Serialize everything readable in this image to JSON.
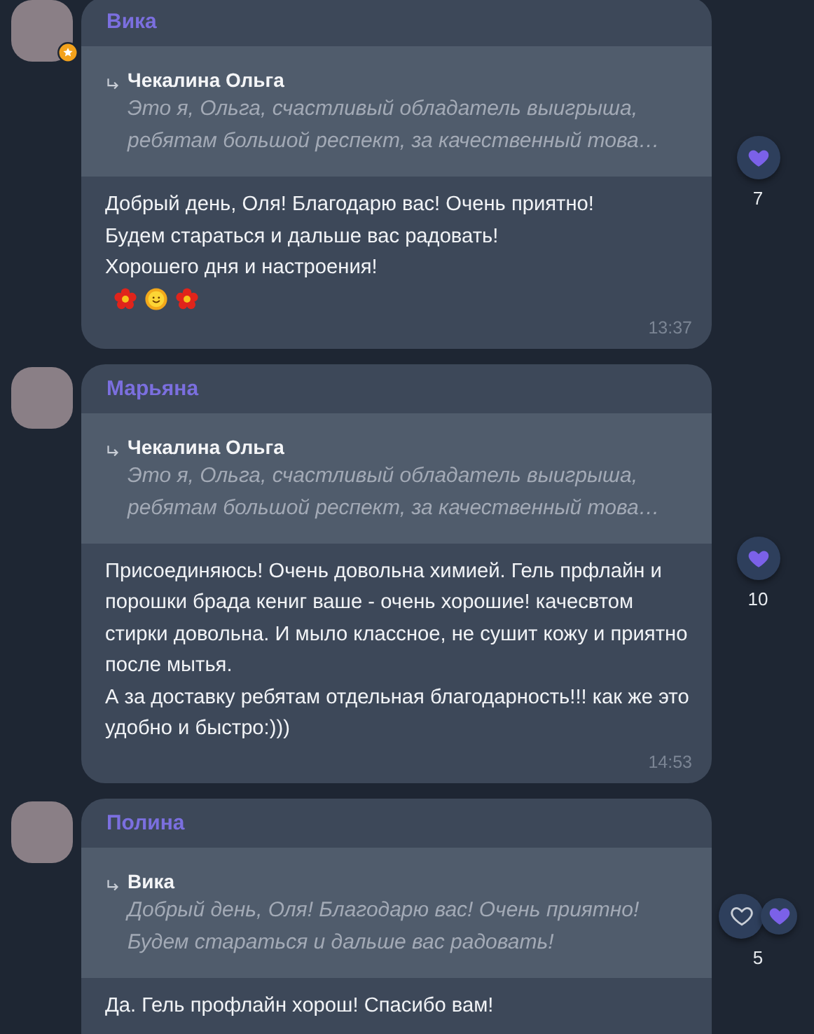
{
  "messages": [
    {
      "author": "Вика",
      "avatar_badge": true,
      "reply": {
        "author": "Чекалина Ольга",
        "text": "Это я, Ольга, счастливый обладатель выигрыша,\nребятам большой респект, за качественный това…"
      },
      "text": "Добрый день, Оля! Благодарю вас! Очень приятно!\nБудем стараться и дальше вас радовать!\nХорошего дня и настроения!",
      "emoji": [
        {
          "kind": "flower"
        },
        {
          "kind": "sun"
        },
        {
          "kind": "flower"
        }
      ],
      "time": "13:37",
      "reactions": {
        "hearts": [
          {
            "filled": true
          }
        ],
        "count": "7"
      }
    },
    {
      "author": "Марьяна",
      "avatar_badge": false,
      "reply": {
        "author": "Чекалина Ольга",
        "text": "Это я, Ольга, счастливый обладатель выигрыша,\nребятам большой респект, за качественный това…"
      },
      "text": "Присоединяюсь! Очень довольна химией. Гель прфлайн и порошки брада кениг ваше - очень хорошие! качесвтом стирки довольна.  И мыло классное, не сушит кожу и приятно после мытья.\nА за доставку ребятам отдельная благодарность!!! как же это удобно и быстро:)))",
      "time": "14:53",
      "reactions": {
        "hearts": [
          {
            "filled": true
          }
        ],
        "count": "10"
      }
    },
    {
      "author": "Полина",
      "avatar_badge": false,
      "reply": {
        "author": "Вика",
        "text": "Добрый день, Оля! Благодарю вас! Очень приятно!\nБудем стараться и дальше вас радовать!"
      },
      "text": "Да. Гель профлайн хорош! Спасибо вам!",
      "reactions": {
        "hearts": [
          {
            "filled": false
          },
          {
            "filled": true
          }
        ],
        "count": "5"
      }
    }
  ]
}
